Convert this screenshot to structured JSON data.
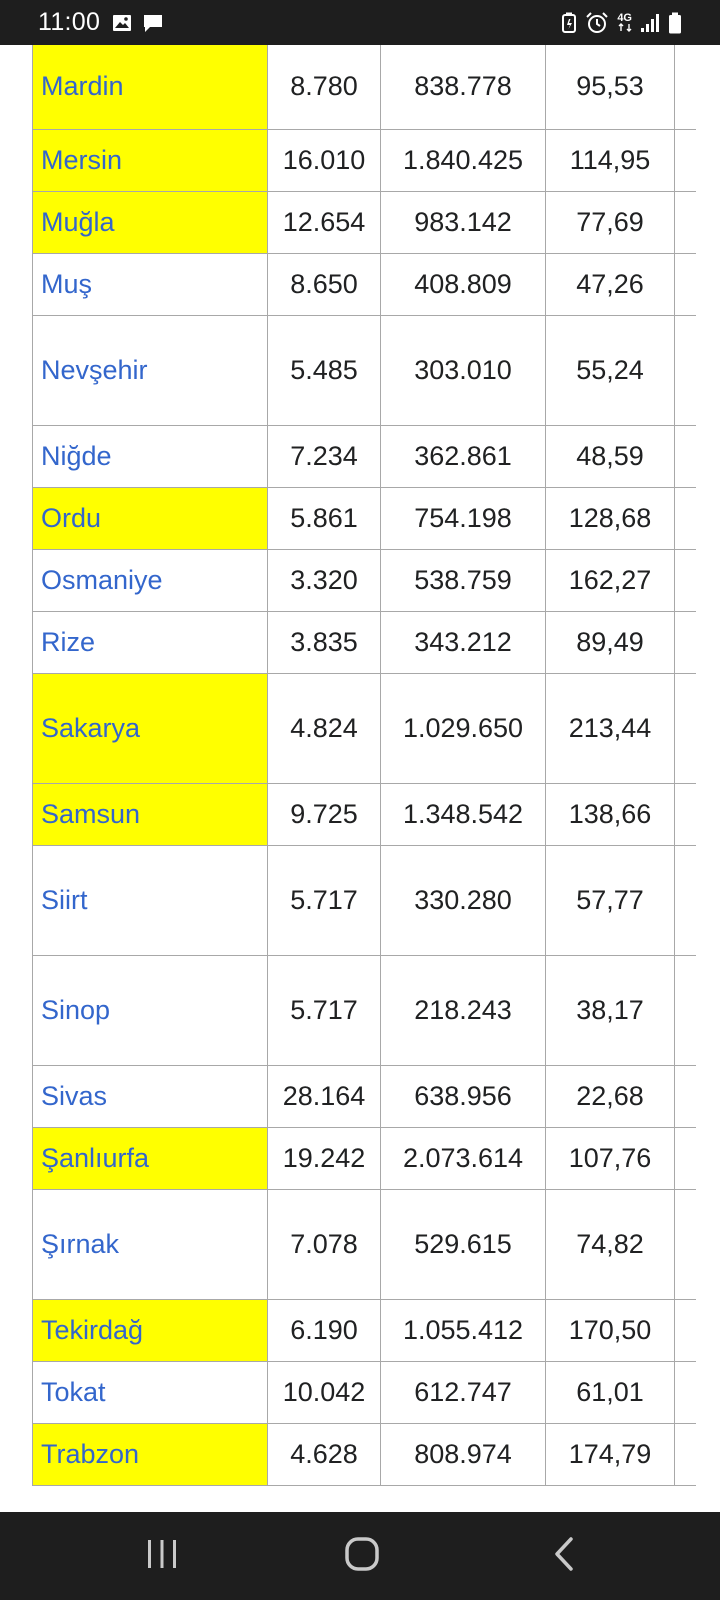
{
  "status_bar": {
    "time": "11:00",
    "left_icons": [
      "image-icon",
      "message-icon"
    ],
    "right_icons": [
      "battery-saver-icon",
      "alarm-icon",
      "network-4g-icon",
      "signal-icon",
      "battery-icon"
    ],
    "network_label": "4G"
  },
  "table": {
    "rows": [
      {
        "name": "Mardin",
        "area": "8.780",
        "population": "838.778",
        "density": "95,53",
        "highlight": true,
        "tall": 1
      },
      {
        "name": "Mersin",
        "area": "16.010",
        "population": "1.840.425",
        "density": "114,95",
        "highlight": true,
        "tall": 0
      },
      {
        "name": "Muğla",
        "area": "12.654",
        "population": "983.142",
        "density": "77,69",
        "highlight": true,
        "tall": 0
      },
      {
        "name": "Muş",
        "area": "8.650",
        "population": "408.809",
        "density": "47,26",
        "highlight": false,
        "tall": 0
      },
      {
        "name": "Nevşehir",
        "area": "5.485",
        "population": "303.010",
        "density": "55,24",
        "highlight": false,
        "tall": 2
      },
      {
        "name": "Niğde",
        "area": "7.234",
        "population": "362.861",
        "density": "48,59",
        "highlight": false,
        "tall": 0
      },
      {
        "name": "Ordu",
        "area": "5.861",
        "population": "754.198",
        "density": "128,68",
        "highlight": true,
        "tall": 0
      },
      {
        "name": "Osmaniye",
        "area": "3.320",
        "population": "538.759",
        "density": "162,27",
        "highlight": false,
        "tall": 0
      },
      {
        "name": "Rize",
        "area": "3.835",
        "population": "343.212",
        "density": "89,49",
        "highlight": false,
        "tall": 0
      },
      {
        "name": "Sakarya",
        "area": "4.824",
        "population": "1.029.650",
        "density": "213,44",
        "highlight": true,
        "tall": 2
      },
      {
        "name": "Samsun",
        "area": "9.725",
        "population": "1.348.542",
        "density": "138,66",
        "highlight": true,
        "tall": 0
      },
      {
        "name": "Siirt",
        "area": "5.717",
        "population": "330.280",
        "density": "57,77",
        "highlight": false,
        "tall": 2
      },
      {
        "name": "Sinop",
        "area": "5.717",
        "population": "218.243",
        "density": "38,17",
        "highlight": false,
        "tall": 2
      },
      {
        "name": "Sivas",
        "area": "28.164",
        "population": "638.956",
        "density": "22,68",
        "highlight": false,
        "tall": 0
      },
      {
        "name": "Şanlıurfa",
        "area": "19.242",
        "population": "2.073.614",
        "density": "107,76",
        "highlight": true,
        "tall": 0
      },
      {
        "name": "Şırnak",
        "area": "7.078",
        "population": "529.615",
        "density": "74,82",
        "highlight": false,
        "tall": 2
      },
      {
        "name": "Tekirdağ",
        "area": "6.190",
        "population": "1.055.412",
        "density": "170,50",
        "highlight": true,
        "tall": 0
      },
      {
        "name": "Tokat",
        "area": "10.042",
        "population": "612.747",
        "density": "61,01",
        "highlight": false,
        "tall": 0
      },
      {
        "name": "Trabzon",
        "area": "4.628",
        "population": "808.974",
        "density": "174,79",
        "highlight": true,
        "tall": 0
      }
    ],
    "highlight_color": "#ffff00",
    "link_color": "#3366cc"
  },
  "nav_bar": {
    "buttons": [
      "recent-apps-icon",
      "home-icon",
      "back-icon"
    ]
  }
}
